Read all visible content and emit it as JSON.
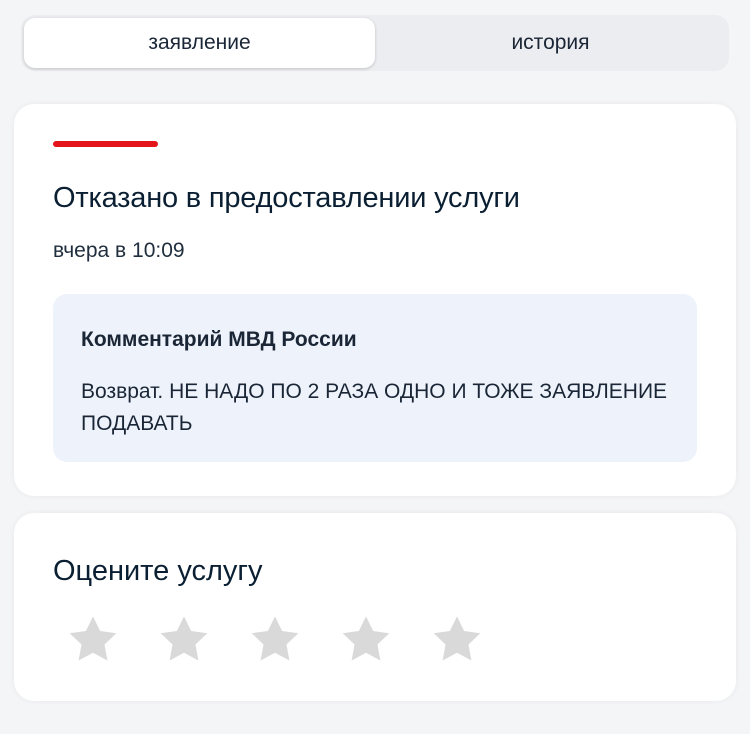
{
  "tabs": [
    {
      "label": "заявление",
      "active": true
    },
    {
      "label": "история",
      "active": false
    }
  ],
  "status": {
    "title": "Отказано в предоставлении услуги",
    "time": "вчера в 10:09",
    "color": "#e3151b"
  },
  "comment": {
    "author": "Комментарий МВД России",
    "text": "Возврат. НЕ НАДО ПО 2 РАЗА ОДНО И ТОЖЕ ЗАЯВЛЕНИЕ ПОДАВАТЬ"
  },
  "rating": {
    "title": "Оцените услугу",
    "max": 5,
    "value": 0,
    "icon": "star-icon",
    "empty_color": "#d9d9d9"
  }
}
